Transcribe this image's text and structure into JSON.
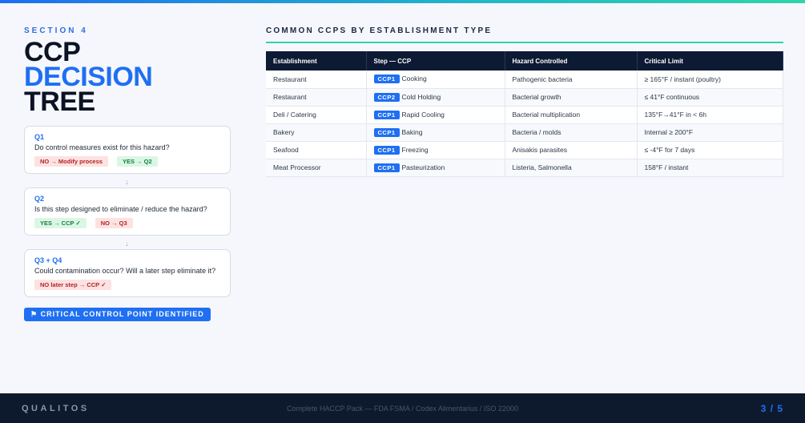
{
  "header": {
    "section_label": "SECTION 4",
    "title_line1": "CCP",
    "title_line2": "DECISION",
    "title_line3": "TREE"
  },
  "decision_tree": {
    "q1": {
      "label": "Q1",
      "text": "Do control measures exist for this hazard?",
      "badges": [
        "NO → Modify process",
        "YES → Q2"
      ]
    },
    "q2": {
      "label": "Q2",
      "text": "Is this step designed to eliminate / reduce the hazard?",
      "badges": [
        "YES → CCP ✓",
        "NO → Q3"
      ]
    },
    "q3": {
      "label": "Q3 + Q4",
      "text": "Could contamination occur? Will a later step eliminate it?",
      "badges": [
        "NO later step → CCP ✓"
      ]
    },
    "arrow": "↓",
    "identified_label": "⚑ CRITICAL CONTROL POINT IDENTIFIED"
  },
  "table": {
    "heading": "COMMON CCPS BY ESTABLISHMENT TYPE",
    "columns": [
      "Establishment",
      "Step — CCP",
      "Hazard Controlled",
      "Critical Limit"
    ],
    "rows": [
      {
        "establishment": "Restaurant",
        "ccp": "CCP1",
        "step": "Cooking",
        "hazard": "Pathogenic bacteria",
        "limit": "≥ 165°F / instant (poultry)"
      },
      {
        "establishment": "Restaurant",
        "ccp": "CCP2",
        "step": "Cold Holding",
        "hazard": "Bacterial growth",
        "limit": "≤ 41°F continuous"
      },
      {
        "establishment": "Deli / Catering",
        "ccp": "CCP1",
        "step": "Rapid Cooling",
        "hazard": "Bacterial multiplication",
        "limit": "135°F→41°F in < 6h"
      },
      {
        "establishment": "Bakery",
        "ccp": "CCP1",
        "step": "Baking",
        "hazard": "Bacteria / molds",
        "limit": "Internal ≥ 200°F"
      },
      {
        "establishment": "Seafood",
        "ccp": "CCP1",
        "step": "Freezing",
        "hazard": "Anisakis parasites",
        "limit": "≤ -4°F for 7 days"
      },
      {
        "establishment": "Meat Processor",
        "ccp": "CCP1",
        "step": "Pasteurization",
        "hazard": "Listeria, Salmonella",
        "limit": "158°F / instant"
      }
    ]
  },
  "footer": {
    "brand": "QUALITOS",
    "center_text": "Complete HACCP Pack — FDA FSMA / Codex Alimentarius / ISO 22000",
    "page": "3 / 5"
  },
  "colors": {
    "accent": "#1f6ff2",
    "navy": "#0d1a33",
    "teal": "#2fd4a8"
  }
}
